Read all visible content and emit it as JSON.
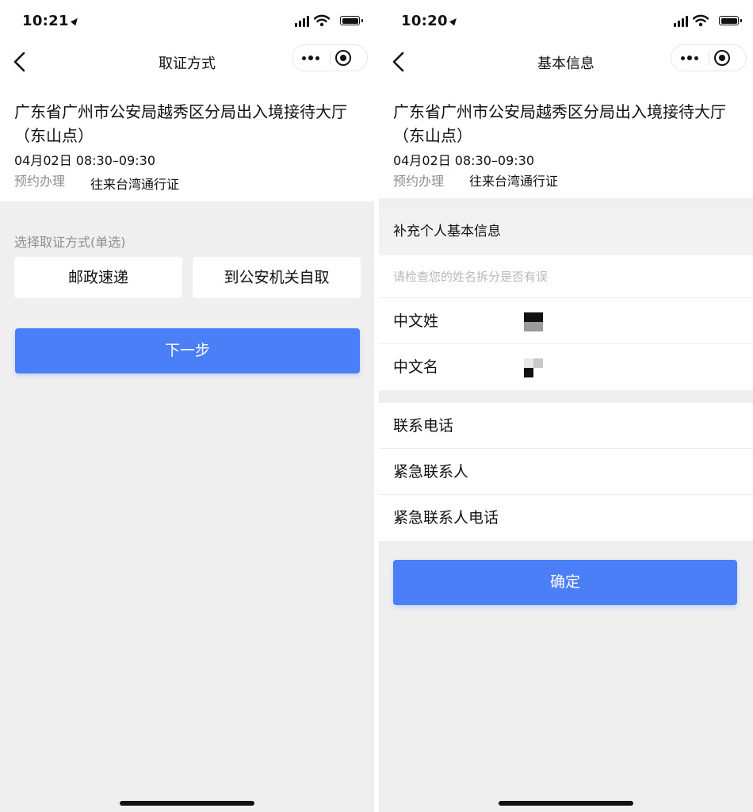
{
  "left": {
    "status": {
      "time": "10:21"
    },
    "nav": {
      "title": "取证方式"
    },
    "info": {
      "hall_name": "广东省广州市公安局越秀区分局出入境接待大厅（东山点）",
      "date": "04月02日 08:30–09:30",
      "type_label": "预约办理",
      "type_value": "往来台湾通行证"
    },
    "choose_label": "选择取证方式(单选)",
    "options": [
      "邮政速递",
      "到公安机关自取"
    ],
    "next_label": "下一步"
  },
  "right": {
    "status": {
      "time": "10:20"
    },
    "nav": {
      "title": "基本信息"
    },
    "info": {
      "hall_name": "广东省广州市公安局越秀区分局出入境接待大厅（东山点）",
      "date": "04月02日 08:30–09:30",
      "type_label": "预约办理",
      "type_value": "往来台湾通行证"
    },
    "section_title": "补充个人基本信息",
    "name_hint": "请检查您的姓名拆分是否有误",
    "fields": {
      "surname": "中文姓",
      "given_name": "中文名",
      "phone": "联系电话",
      "emergency_contact": "紧急联系人",
      "emergency_phone": "紧急联系人电话"
    },
    "confirm_label": "确定"
  },
  "colors": {
    "primary": "#4a7ff7",
    "background": "#efeff0",
    "muted_text": "#8f8f94"
  }
}
